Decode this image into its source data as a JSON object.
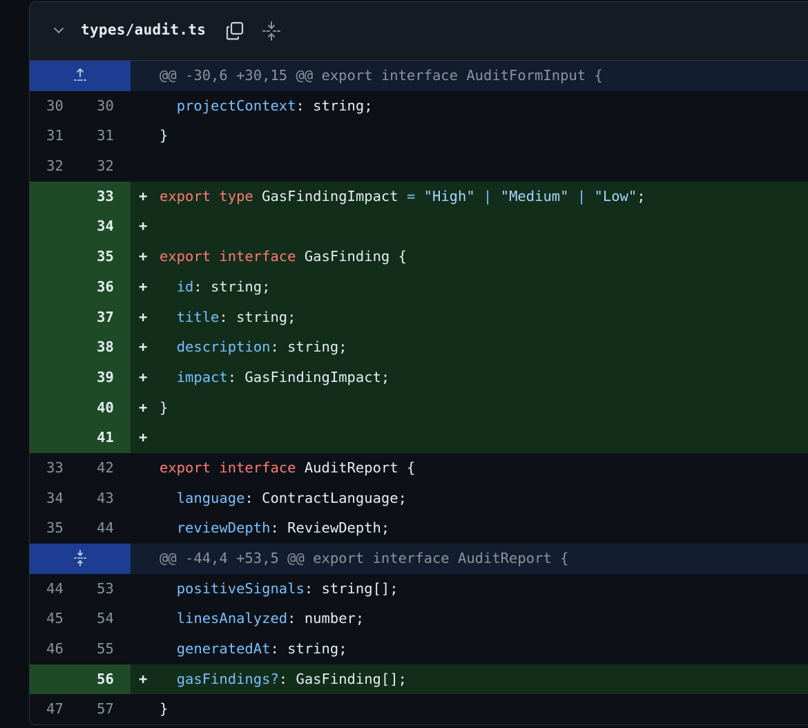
{
  "file": {
    "name": "types/audit.ts",
    "icons": {
      "collapse": "chevron-down-icon",
      "copy": "copy-icon",
      "expand": "expand-all-icon"
    }
  },
  "rows": [
    {
      "type": "hunk",
      "icon": "expand-up-icon",
      "text": "@@ -30,6 +30,15 @@ export interface AuditFormInput {"
    },
    {
      "type": "ctx",
      "old": "30",
      "new": "30",
      "tokens": [
        [
          "  ",
          "plain"
        ],
        [
          "projectContext",
          "prop"
        ],
        [
          ": string;",
          "plain"
        ]
      ]
    },
    {
      "type": "ctx",
      "old": "31",
      "new": "31",
      "tokens": [
        [
          "}",
          "plain"
        ]
      ]
    },
    {
      "type": "ctx",
      "old": "32",
      "new": "32",
      "tokens": []
    },
    {
      "type": "add",
      "old": "",
      "new": "33",
      "tokens": [
        [
          "export",
          "kw"
        ],
        [
          " ",
          "plain"
        ],
        [
          "type",
          "kw"
        ],
        [
          " GasFindingImpact ",
          "plain"
        ],
        [
          "=",
          "op"
        ],
        [
          " ",
          "plain"
        ],
        [
          "\"High\"",
          "str"
        ],
        [
          " ",
          "plain"
        ],
        [
          "|",
          "op"
        ],
        [
          " ",
          "plain"
        ],
        [
          "\"Medium\"",
          "str"
        ],
        [
          " ",
          "plain"
        ],
        [
          "|",
          "op"
        ],
        [
          " ",
          "plain"
        ],
        [
          "\"Low\"",
          "str"
        ],
        [
          ";",
          "plain"
        ]
      ]
    },
    {
      "type": "add",
      "old": "",
      "new": "34",
      "tokens": []
    },
    {
      "type": "add",
      "old": "",
      "new": "35",
      "tokens": [
        [
          "export",
          "kw"
        ],
        [
          " ",
          "plain"
        ],
        [
          "interface",
          "kw"
        ],
        [
          " GasFinding {",
          "plain"
        ]
      ]
    },
    {
      "type": "add",
      "old": "",
      "new": "36",
      "tokens": [
        [
          "  ",
          "plain"
        ],
        [
          "id",
          "prop"
        ],
        [
          ": string;",
          "plain"
        ]
      ]
    },
    {
      "type": "add",
      "old": "",
      "new": "37",
      "tokens": [
        [
          "  ",
          "plain"
        ],
        [
          "title",
          "prop"
        ],
        [
          ": string;",
          "plain"
        ]
      ]
    },
    {
      "type": "add",
      "old": "",
      "new": "38",
      "tokens": [
        [
          "  ",
          "plain"
        ],
        [
          "description",
          "prop"
        ],
        [
          ": string;",
          "plain"
        ]
      ]
    },
    {
      "type": "add",
      "old": "",
      "new": "39",
      "tokens": [
        [
          "  ",
          "plain"
        ],
        [
          "impact",
          "prop"
        ],
        [
          ": GasFindingImpact;",
          "plain"
        ]
      ]
    },
    {
      "type": "add",
      "old": "",
      "new": "40",
      "tokens": [
        [
          "}",
          "plain"
        ]
      ]
    },
    {
      "type": "add",
      "old": "",
      "new": "41",
      "tokens": []
    },
    {
      "type": "ctx",
      "old": "33",
      "new": "42",
      "tokens": [
        [
          "export",
          "kw"
        ],
        [
          " ",
          "plain"
        ],
        [
          "interface",
          "kw"
        ],
        [
          " AuditReport {",
          "plain"
        ]
      ]
    },
    {
      "type": "ctx",
      "old": "34",
      "new": "43",
      "tokens": [
        [
          "  ",
          "plain"
        ],
        [
          "language",
          "prop"
        ],
        [
          ": ContractLanguage;",
          "plain"
        ]
      ]
    },
    {
      "type": "ctx",
      "old": "35",
      "new": "44",
      "tokens": [
        [
          "  ",
          "plain"
        ],
        [
          "reviewDepth",
          "prop"
        ],
        [
          ": ReviewDepth;",
          "plain"
        ]
      ]
    },
    {
      "type": "hunk",
      "icon": "expand-both-icon",
      "text": "@@ -44,4 +53,5 @@ export interface AuditReport {"
    },
    {
      "type": "ctx",
      "old": "44",
      "new": "53",
      "tokens": [
        [
          "  ",
          "plain"
        ],
        [
          "positiveSignals",
          "prop"
        ],
        [
          ": string[];",
          "plain"
        ]
      ]
    },
    {
      "type": "ctx",
      "old": "45",
      "new": "54",
      "tokens": [
        [
          "  ",
          "plain"
        ],
        [
          "linesAnalyzed",
          "prop"
        ],
        [
          ": number;",
          "plain"
        ]
      ]
    },
    {
      "type": "ctx",
      "old": "46",
      "new": "55",
      "tokens": [
        [
          "  ",
          "plain"
        ],
        [
          "generatedAt",
          "prop"
        ],
        [
          ": string;",
          "plain"
        ]
      ]
    },
    {
      "type": "add",
      "old": "",
      "new": "56",
      "tokens": [
        [
          "  ",
          "plain"
        ],
        [
          "gasFindings?",
          "prop"
        ],
        [
          ": GasFinding[];",
          "plain"
        ]
      ]
    },
    {
      "type": "ctx",
      "old": "47",
      "new": "57",
      "tokens": [
        [
          "}",
          "plain"
        ]
      ]
    }
  ]
}
